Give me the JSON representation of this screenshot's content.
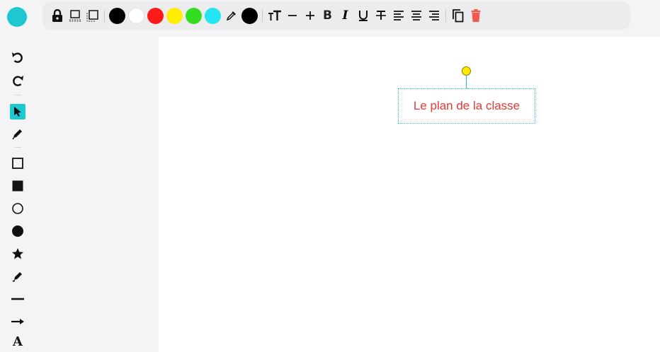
{
  "brand": {
    "color": "#1ec8cf"
  },
  "toolbar": {
    "colors": [
      "#000000",
      "#ffffff",
      "#ff1a1a",
      "#ffee00",
      "#33dd22",
      "#22e6f2"
    ],
    "current_color": "#000000",
    "bold_label": "B",
    "italic_label": "I"
  },
  "sidebar": {
    "active_tool": "select",
    "text_tool_label": "A"
  },
  "canvas": {
    "text_object": {
      "text": "Le plan de la classe",
      "color": "#e53935"
    },
    "selection_color": "#2ab7d4",
    "handle_color": "#ffe900"
  }
}
